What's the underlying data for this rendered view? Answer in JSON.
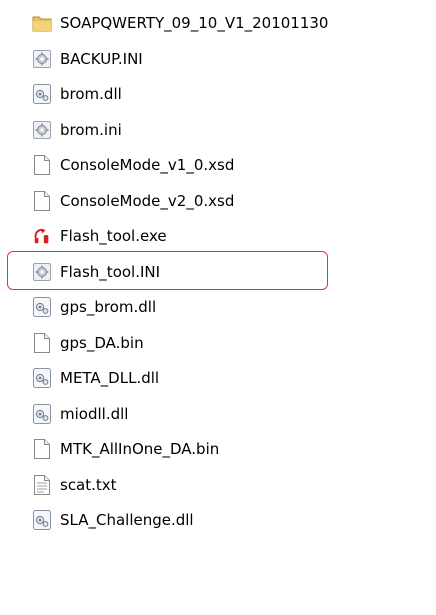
{
  "files": [
    {
      "name": "SOAPQWERTY_09_10_V1_20101130",
      "icon": "folder-icon"
    },
    {
      "name": "BACKUP.INI",
      "icon": "settings-file-icon"
    },
    {
      "name": "brom.dll",
      "icon": "dll-file-icon"
    },
    {
      "name": "brom.ini",
      "icon": "settings-file-icon"
    },
    {
      "name": "ConsoleMode_v1_0.xsd",
      "icon": "blank-file-icon"
    },
    {
      "name": "ConsoleMode_v2_0.xsd",
      "icon": "blank-file-icon"
    },
    {
      "name": "Flash_tool.exe",
      "icon": "flash-tool-app-icon"
    },
    {
      "name": "Flash_tool.INI",
      "icon": "settings-file-icon"
    },
    {
      "name": "gps_brom.dll",
      "icon": "dll-file-icon"
    },
    {
      "name": "gps_DA.bin",
      "icon": "blank-file-icon"
    },
    {
      "name": "META_DLL.dll",
      "icon": "dll-file-icon"
    },
    {
      "name": "miodll.dll",
      "icon": "dll-file-icon"
    },
    {
      "name": "MTK_AllInOne_DA.bin",
      "icon": "blank-file-icon"
    },
    {
      "name": "scat.txt",
      "icon": "text-file-icon"
    },
    {
      "name": "SLA_Challenge.dll",
      "icon": "dll-file-icon"
    }
  ],
  "colors": {
    "highlight": "#d9373a",
    "folder": "#e8c15a"
  }
}
